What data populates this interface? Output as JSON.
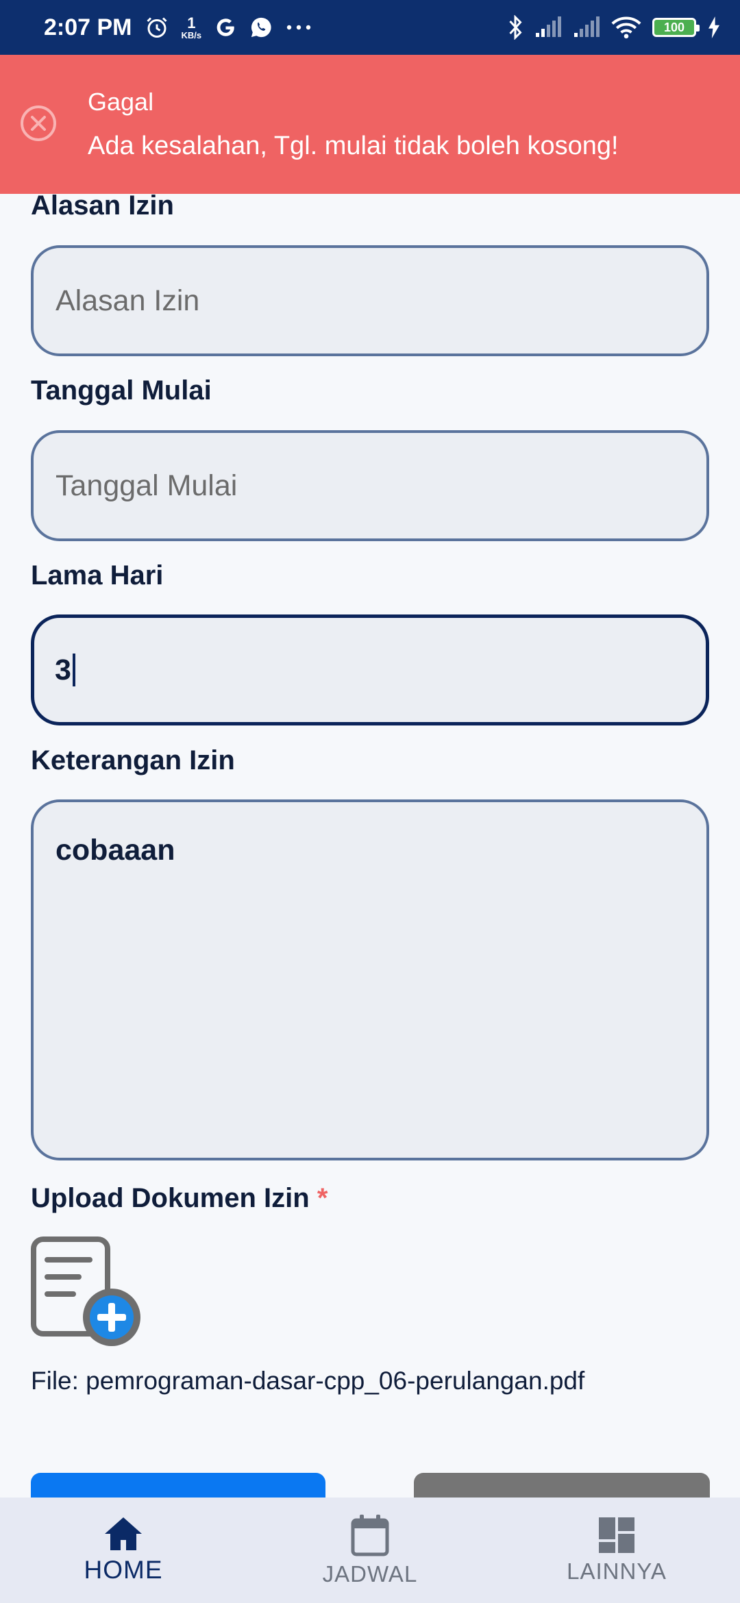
{
  "status_bar": {
    "time": "2:07 PM",
    "net_speed_value": "1",
    "net_speed_unit": "KB/s",
    "battery": "100",
    "icons": [
      "alarm-icon",
      "google-icon",
      "whatsapp-icon",
      "more-icon",
      "bluetooth-icon",
      "signal-icon",
      "signal-icon",
      "wifi-icon",
      "battery-icon",
      "charging-icon"
    ]
  },
  "toast": {
    "title": "Gagal",
    "message": "Ada kesalahan, Tgl. mulai tidak boleh kosong!",
    "icon": "close-circle-icon",
    "color": "#ef6363"
  },
  "form": {
    "alasan": {
      "label": "Alasan Izin",
      "placeholder": "Alasan Izin",
      "value": ""
    },
    "tanggal": {
      "label": "Tanggal Mulai",
      "placeholder": "Tanggal Mulai",
      "value": ""
    },
    "lama": {
      "label": "Lama Hari",
      "value": "3"
    },
    "keterangan": {
      "label": "Keterangan Izin",
      "value": "cobaaan"
    },
    "upload": {
      "label": "Upload Dokumen Izin",
      "required_mark": "*",
      "file_text": "File: pemrograman-dasar-cpp_06-perulangan.pdf"
    }
  },
  "buttons": {
    "submit_color": "#0a78f2",
    "cancel_color": "#757575"
  },
  "bottom_nav": {
    "items": [
      {
        "label": "HOME",
        "icon": "home-icon",
        "active": true
      },
      {
        "label": "JADWAL",
        "icon": "calendar-icon",
        "active": false
      },
      {
        "label": "LAINNYA",
        "icon": "dashboard-icon",
        "active": false
      }
    ]
  }
}
